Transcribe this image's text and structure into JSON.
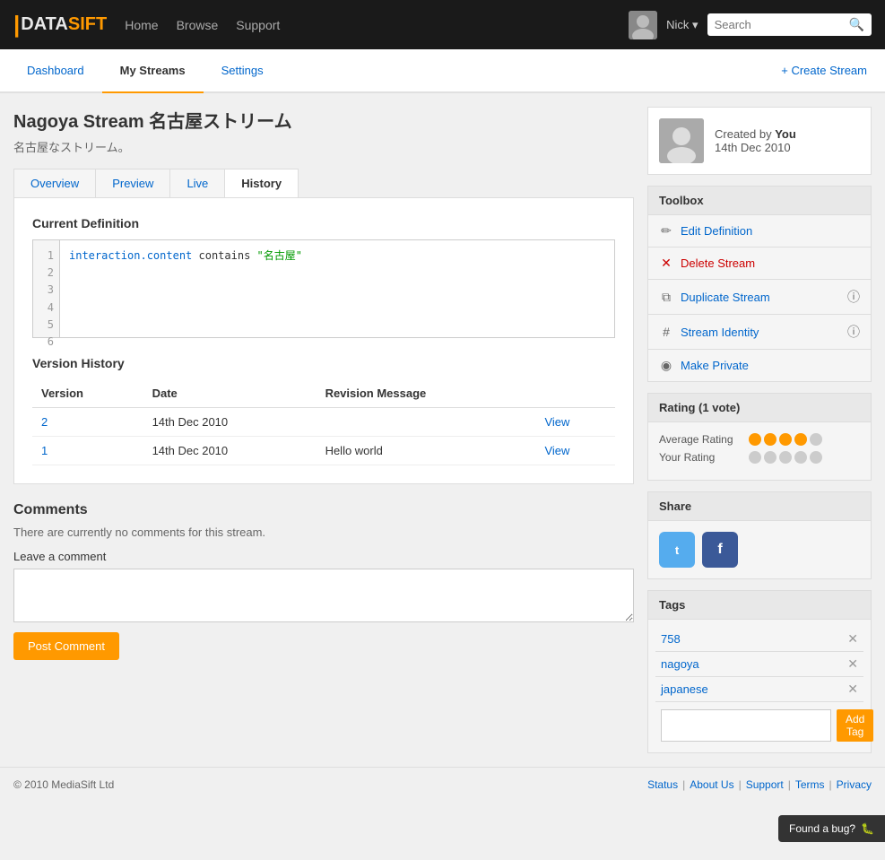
{
  "header": {
    "logo_data": "DATA",
    "logo_sift": "SIFT",
    "nav": [
      "Home",
      "Browse",
      "Support"
    ],
    "user": "Nick",
    "search_placeholder": "Search"
  },
  "nav_tabs": {
    "tabs": [
      "Dashboard",
      "My Streams",
      "Settings"
    ],
    "active": "My Streams",
    "create_label": "+ Create Stream"
  },
  "page": {
    "title": "Nagoya Stream 名古屋ストリーム",
    "subtitle": "名古屋なストリーム。"
  },
  "content_tabs": [
    "Overview",
    "Preview",
    "Live",
    "History"
  ],
  "active_tab": "History",
  "code_section": {
    "label": "Current Definition",
    "lines": [
      "1",
      "2",
      "3",
      "4",
      "5",
      "6"
    ],
    "code_html": "interaction.content contains \"名古屋\""
  },
  "version_history": {
    "label": "Version History",
    "columns": [
      "Version",
      "Date",
      "Revision Message"
    ],
    "rows": [
      {
        "version": "2",
        "date": "14th Dec 2010",
        "message": "",
        "link": "View"
      },
      {
        "version": "1",
        "date": "14th Dec 2010",
        "message": "Hello world",
        "link": "View"
      }
    ]
  },
  "comments": {
    "title": "Comments",
    "empty_message": "There are currently no comments for this stream.",
    "leave_label": "Leave a comment",
    "post_button": "Post Comment"
  },
  "creator": {
    "by": "Created by",
    "name": "You",
    "date": "14th Dec 2010"
  },
  "toolbox": {
    "title": "Toolbox",
    "items": [
      {
        "label": "Edit Definition",
        "icon": "✏",
        "has_info": false
      },
      {
        "label": "Delete Stream",
        "icon": "✕",
        "has_info": false,
        "is_delete": true
      },
      {
        "label": "Duplicate Stream",
        "icon": "⧉",
        "has_info": true
      },
      {
        "label": "Stream Identity",
        "icon": "#",
        "has_info": true
      },
      {
        "label": "Make Private",
        "icon": "◉",
        "has_info": false
      }
    ]
  },
  "rating": {
    "title": "Rating (1 vote)",
    "average_label": "Average Rating",
    "your_label": "Your Rating",
    "average_filled": 4,
    "average_empty": 1,
    "your_filled": 0,
    "your_empty": 5
  },
  "share": {
    "title": "Share"
  },
  "tags": {
    "title": "Tags",
    "items": [
      "758",
      "nagoya",
      "japanese"
    ],
    "add_placeholder": "",
    "add_button": "Add Tag"
  },
  "footer": {
    "copyright": "© 2010 MediaSift Ltd",
    "links": [
      "Status",
      "About Us",
      "Support",
      "Terms",
      "Privacy"
    ]
  },
  "bug_report": {
    "label": "Found a bug?"
  }
}
